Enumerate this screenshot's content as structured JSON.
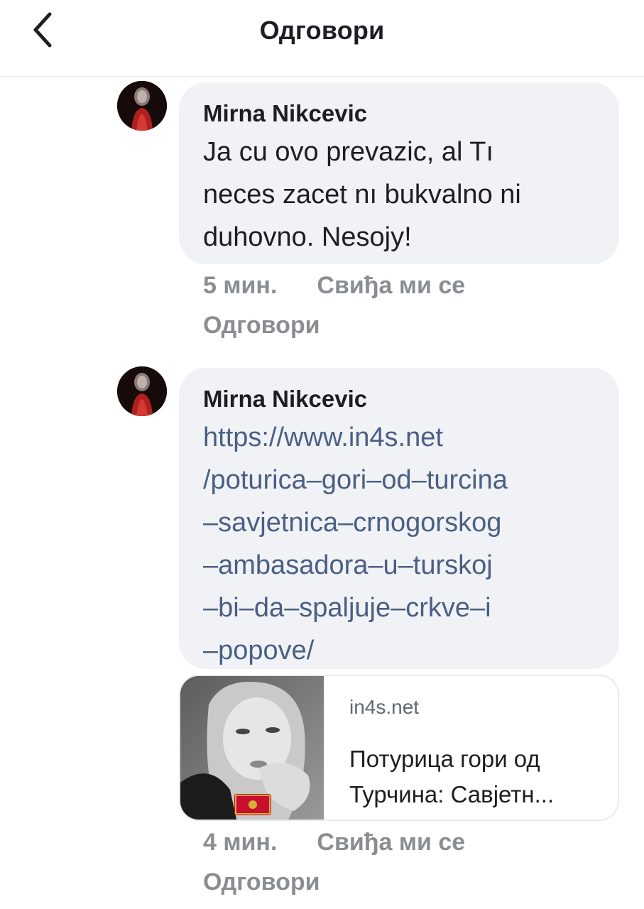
{
  "header": {
    "title": "Одговори",
    "back_icon": "chevron-left-icon"
  },
  "comments": [
    {
      "author": "Mirna Nikcevic",
      "text_lines": [
        "Ja cu ovo prevazic, al Tı",
        "neces zacet nı bukvalno ni",
        "duhovno. Nesojy!"
      ],
      "time": "5 мин.",
      "like": "Свиђа ми се",
      "reply": "Одговори"
    },
    {
      "author": "Mirna Nikcevic",
      "link_lines": [
        "https://www.in4s.net",
        "/poturica–gori–od–turcina",
        "–savjetnica–crnogorskog",
        "–ambasadora–u–turskoj",
        "–bi–da–spaljuje–crkve–i",
        "–popove/"
      ],
      "preview": {
        "domain": "in4s.net",
        "title_lines": [
          "Потурица гори од",
          "Турчина: Савјетн..."
        ]
      },
      "time": "4 мин.",
      "like": "Свиђа ми се",
      "reply": "Одговори"
    }
  ],
  "colors": {
    "bubble": "#f0f2f5",
    "link": "#4b5f84",
    "meta": "#8a8d91",
    "text": "#1c1e21"
  }
}
